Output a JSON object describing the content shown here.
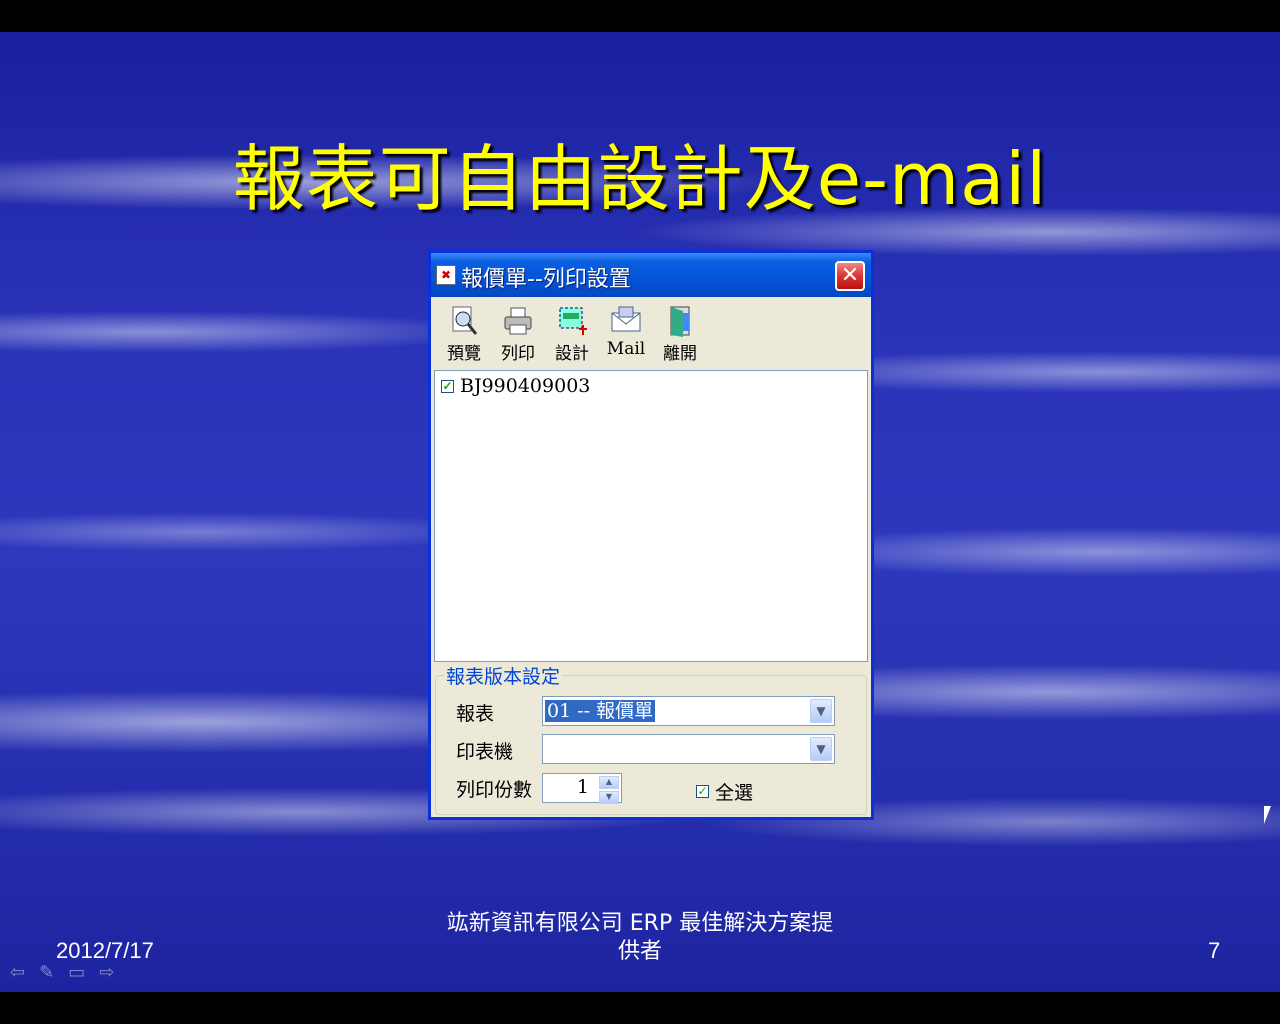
{
  "slide": {
    "title": "報表可自由設計及e-mail",
    "footer_date": "2012/7/17",
    "footer_company": "竑新資訊有限公司  ERP 最佳解決方案提供者",
    "page_number": "7"
  },
  "dialog": {
    "title": "報價單--列印設置",
    "close_label": "✕",
    "toolbar": [
      {
        "label": "預覽",
        "icon": "preview-icon"
      },
      {
        "label": "列印",
        "icon": "printer-icon"
      },
      {
        "label": "設計",
        "icon": "design-icon"
      },
      {
        "label": "Mail",
        "icon": "mail-icon"
      },
      {
        "label": "離開",
        "icon": "exit-door-icon"
      }
    ],
    "list_items": [
      {
        "label": "BJ990409003",
        "checked": true
      }
    ],
    "group_title": "報表版本設定",
    "report_label": "報表",
    "report_value": "01 -- 報價單",
    "printer_label": "印表機",
    "printer_value": "",
    "copies_label": "列印份數",
    "copies_value": "1",
    "select_all_label": "全選",
    "select_all_checked": true
  },
  "colors": {
    "title_color": "#ffff00",
    "dialog_frame": "#0831d9",
    "group_title": "#0046d5",
    "selection": "#316ac5"
  }
}
